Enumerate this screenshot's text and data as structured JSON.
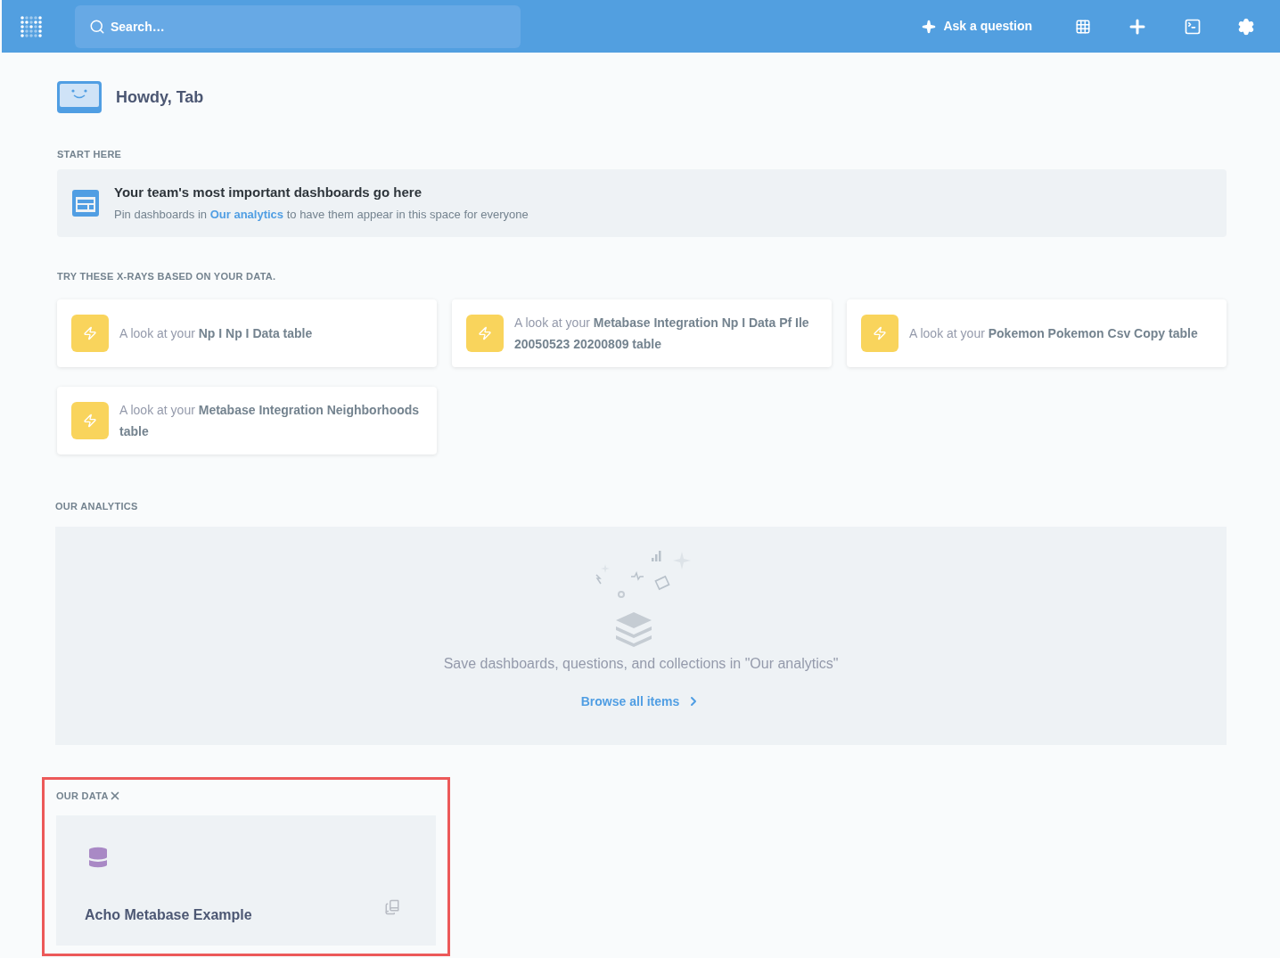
{
  "navbar": {
    "search": {
      "placeholder": "Search…"
    },
    "ask_button": "Ask a question"
  },
  "greeting": "Howdy, Tab",
  "start_here": {
    "heading": "START HERE",
    "title": "Your team's most important dashboards go here",
    "text_before": "Pin dashboards in ",
    "link": "Our analytics",
    "text_after": " to have them appear in this space for everyone"
  },
  "xrays": {
    "heading": "TRY THESE X-RAYS BASED ON YOUR DATA.",
    "items": [
      {
        "prefix": "A look at your ",
        "name": "Np I Np I Data table"
      },
      {
        "prefix": "A look at your ",
        "name": "Metabase Integration Np I Data Pf Ile 20050523 20200809 table"
      },
      {
        "prefix": "A look at your ",
        "name": "Pokemon Pokemon Csv Copy table"
      },
      {
        "prefix": "A look at your ",
        "name": "Metabase Integration Neighborhoods table"
      }
    ]
  },
  "our_analytics": {
    "heading": "OUR ANALYTICS",
    "empty_text": "Save dashboards, questions, and collections in \"Our analytics\"",
    "browse_link": "Browse all items"
  },
  "our_data": {
    "heading": "OUR DATA",
    "highlighted": true,
    "databases": [
      {
        "name": "Acho Metabase Example"
      }
    ]
  }
}
